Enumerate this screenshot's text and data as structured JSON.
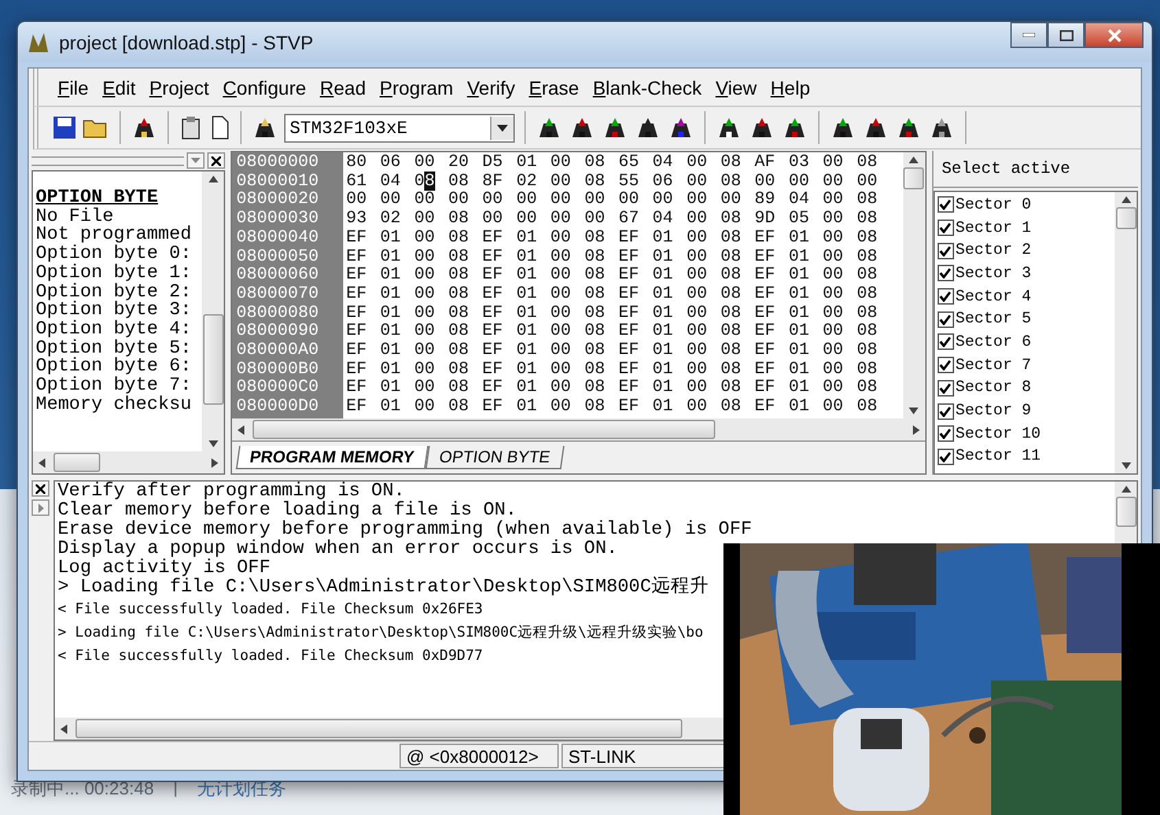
{
  "desktop": {
    "taskbar_texts": [
      "录制中... 00:23:48",
      "|",
      "无计划任务"
    ]
  },
  "window": {
    "title": "project [download.stp] - STVP"
  },
  "menu": [
    "File",
    "Edit",
    "Project",
    "Configure",
    "Read",
    "Program",
    "Verify",
    "Erase",
    "Blank-Check",
    "View",
    "Help"
  ],
  "toolbar": {
    "device": "STM32F103xE"
  },
  "option_panel": {
    "heading": "OPTION BYTE",
    "lines": [
      "No File",
      "Not programmed",
      "Option byte 0:",
      "Option byte 1:",
      "Option byte 2:",
      "Option byte 3:",
      "Option byte 4:",
      "Option byte 5:",
      "Option byte 6:",
      "Option byte 7:",
      "Memory checksu"
    ]
  },
  "memory": {
    "rows": [
      {
        "address": "08000000",
        "bytes": [
          "80",
          "06",
          "00",
          "20",
          "D5",
          "01",
          "00",
          "08",
          "65",
          "04",
          "00",
          "08",
          "AF",
          "03",
          "00",
          "08"
        ]
      },
      {
        "address": "08000010",
        "bytes": [
          "61",
          "04",
          {
            "text": "08",
            "cursor": true
          },
          "08",
          "8F",
          "02",
          "00",
          "08",
          "55",
          "06",
          "00",
          "08",
          "00",
          "00",
          "00",
          "00"
        ]
      },
      {
        "address": "08000020",
        "bytes": [
          "00",
          "00",
          "00",
          "00",
          "00",
          "00",
          "00",
          "00",
          "00",
          "00",
          "00",
          "00",
          "89",
          "04",
          "00",
          "08"
        ]
      },
      {
        "address": "08000030",
        "bytes": [
          "93",
          "02",
          "00",
          "08",
          "00",
          "00",
          "00",
          "00",
          "67",
          "04",
          "00",
          "08",
          "9D",
          "05",
          "00",
          "08"
        ]
      },
      {
        "address": "08000040",
        "bytes": [
          "EF",
          "01",
          "00",
          "08",
          "EF",
          "01",
          "00",
          "08",
          "EF",
          "01",
          "00",
          "08",
          "EF",
          "01",
          "00",
          "08"
        ]
      },
      {
        "address": "08000050",
        "bytes": [
          "EF",
          "01",
          "00",
          "08",
          "EF",
          "01",
          "00",
          "08",
          "EF",
          "01",
          "00",
          "08",
          "EF",
          "01",
          "00",
          "08"
        ]
      },
      {
        "address": "08000060",
        "bytes": [
          "EF",
          "01",
          "00",
          "08",
          "EF",
          "01",
          "00",
          "08",
          "EF",
          "01",
          "00",
          "08",
          "EF",
          "01",
          "00",
          "08"
        ]
      },
      {
        "address": "08000070",
        "bytes": [
          "EF",
          "01",
          "00",
          "08",
          "EF",
          "01",
          "00",
          "08",
          "EF",
          "01",
          "00",
          "08",
          "EF",
          "01",
          "00",
          "08"
        ]
      },
      {
        "address": "08000080",
        "bytes": [
          "EF",
          "01",
          "00",
          "08",
          "EF",
          "01",
          "00",
          "08",
          "EF",
          "01",
          "00",
          "08",
          "EF",
          "01",
          "00",
          "08"
        ]
      },
      {
        "address": "08000090",
        "bytes": [
          "EF",
          "01",
          "00",
          "08",
          "EF",
          "01",
          "00",
          "08",
          "EF",
          "01",
          "00",
          "08",
          "EF",
          "01",
          "00",
          "08"
        ]
      },
      {
        "address": "080000A0",
        "bytes": [
          "EF",
          "01",
          "00",
          "08",
          "EF",
          "01",
          "00",
          "08",
          "EF",
          "01",
          "00",
          "08",
          "EF",
          "01",
          "00",
          "08"
        ]
      },
      {
        "address": "080000B0",
        "bytes": [
          "EF",
          "01",
          "00",
          "08",
          "EF",
          "01",
          "00",
          "08",
          "EF",
          "01",
          "00",
          "08",
          "EF",
          "01",
          "00",
          "08"
        ]
      },
      {
        "address": "080000C0",
        "bytes": [
          "EF",
          "01",
          "00",
          "08",
          "EF",
          "01",
          "00",
          "08",
          "EF",
          "01",
          "00",
          "08",
          "EF",
          "01",
          "00",
          "08"
        ]
      },
      {
        "address": "080000D0",
        "bytes": [
          "EF",
          "01",
          "00",
          "08",
          "EF",
          "01",
          "00",
          "08",
          "EF",
          "01",
          "00",
          "08",
          "EF",
          "01",
          "00",
          "08"
        ]
      }
    ],
    "tabs": [
      {
        "label": "PROGRAM MEMORY",
        "selected": true
      },
      {
        "label": "OPTION BYTE",
        "selected": false
      }
    ]
  },
  "sectors": {
    "heading": "Select active",
    "items": [
      {
        "label": "Sector 0",
        "checked": true
      },
      {
        "label": "Sector 1",
        "checked": true
      },
      {
        "label": "Sector 2",
        "checked": true
      },
      {
        "label": "Sector 3",
        "checked": true
      },
      {
        "label": "Sector 4",
        "checked": true
      },
      {
        "label": "Sector 5",
        "checked": true
      },
      {
        "label": "Sector 6",
        "checked": true
      },
      {
        "label": "Sector 7",
        "checked": true
      },
      {
        "label": "Sector 8",
        "checked": true
      },
      {
        "label": "Sector 9",
        "checked": true
      },
      {
        "label": "Sector 10",
        "checked": true
      },
      {
        "label": "Sector 11",
        "checked": true
      }
    ]
  },
  "log": [
    {
      "kind": "large",
      "text": "Verify after programming is ON."
    },
    {
      "kind": "large",
      "text": "Clear memory before loading a file is ON."
    },
    {
      "kind": "large",
      "text": "Erase device memory before programming (when available) is OFF"
    },
    {
      "kind": "large",
      "text": "Display a popup window when an error occurs is ON."
    },
    {
      "kind": "large",
      "text": "Log activity is OFF"
    },
    {
      "kind": "large",
      "text": "> Loading file C:\\Users\\Administrator\\Desktop\\SIM800C远程升"
    },
    {
      "kind": "small",
      "text": "< File successfully loaded. File Checksum 0x26FE3"
    },
    {
      "kind": "small",
      "text": "> Loading file C:\\Users\\Administrator\\Desktop\\SIM800C远程升级\\远程升级实验\\bo"
    },
    {
      "kind": "small",
      "text": "< File successfully loaded. File Checksum 0xD9D77"
    }
  ],
  "status_bar": [
    "@ <0x8000012>",
    "ST-LINK"
  ],
  "overlay": {
    "kind": "picture"
  }
}
